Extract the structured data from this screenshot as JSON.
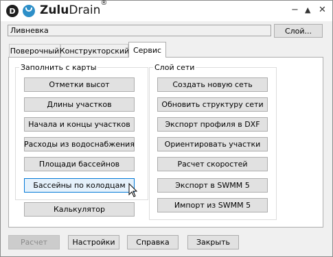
{
  "app": {
    "name_bold": "Zulu",
    "name_regular": "Drain",
    "registered": "®",
    "logo_letter": "D"
  },
  "title_controls": {
    "minimize": "−",
    "restore": "▲",
    "close": "✕"
  },
  "layer": {
    "value": "Ливневка",
    "button": "Слой..."
  },
  "tabs": [
    {
      "label": "Поверочный",
      "active": false
    },
    {
      "label": "Конструкторский",
      "active": false
    },
    {
      "label": "Сервис",
      "active": true
    }
  ],
  "left_group": {
    "title": "Заполнить с карты",
    "buttons": [
      "Отметки высот",
      "Длины участков",
      "Начала и концы участков",
      "Расходы из водоснабжения",
      "Площади бассейнов",
      "Бассейны по колодцам"
    ]
  },
  "calculator_button": "Калькулятор",
  "right_group": {
    "title": "Слой сети",
    "buttons": [
      "Создать новую сеть",
      "Обновить структуру сети",
      "Экспорт профиля в DXF",
      "Ориентировать участки",
      "Расчет скоростей",
      "Экспорт в SWMM 5",
      "Импорт из SWMM 5"
    ]
  },
  "footer": {
    "calc": "Расчет",
    "settings": "Настройки",
    "help": "Справка",
    "close": "Закрыть"
  },
  "colors": {
    "accent": "#0078d7",
    "hover_fill": "#e5f1fb",
    "logo_blue": "#2d8fc8"
  }
}
